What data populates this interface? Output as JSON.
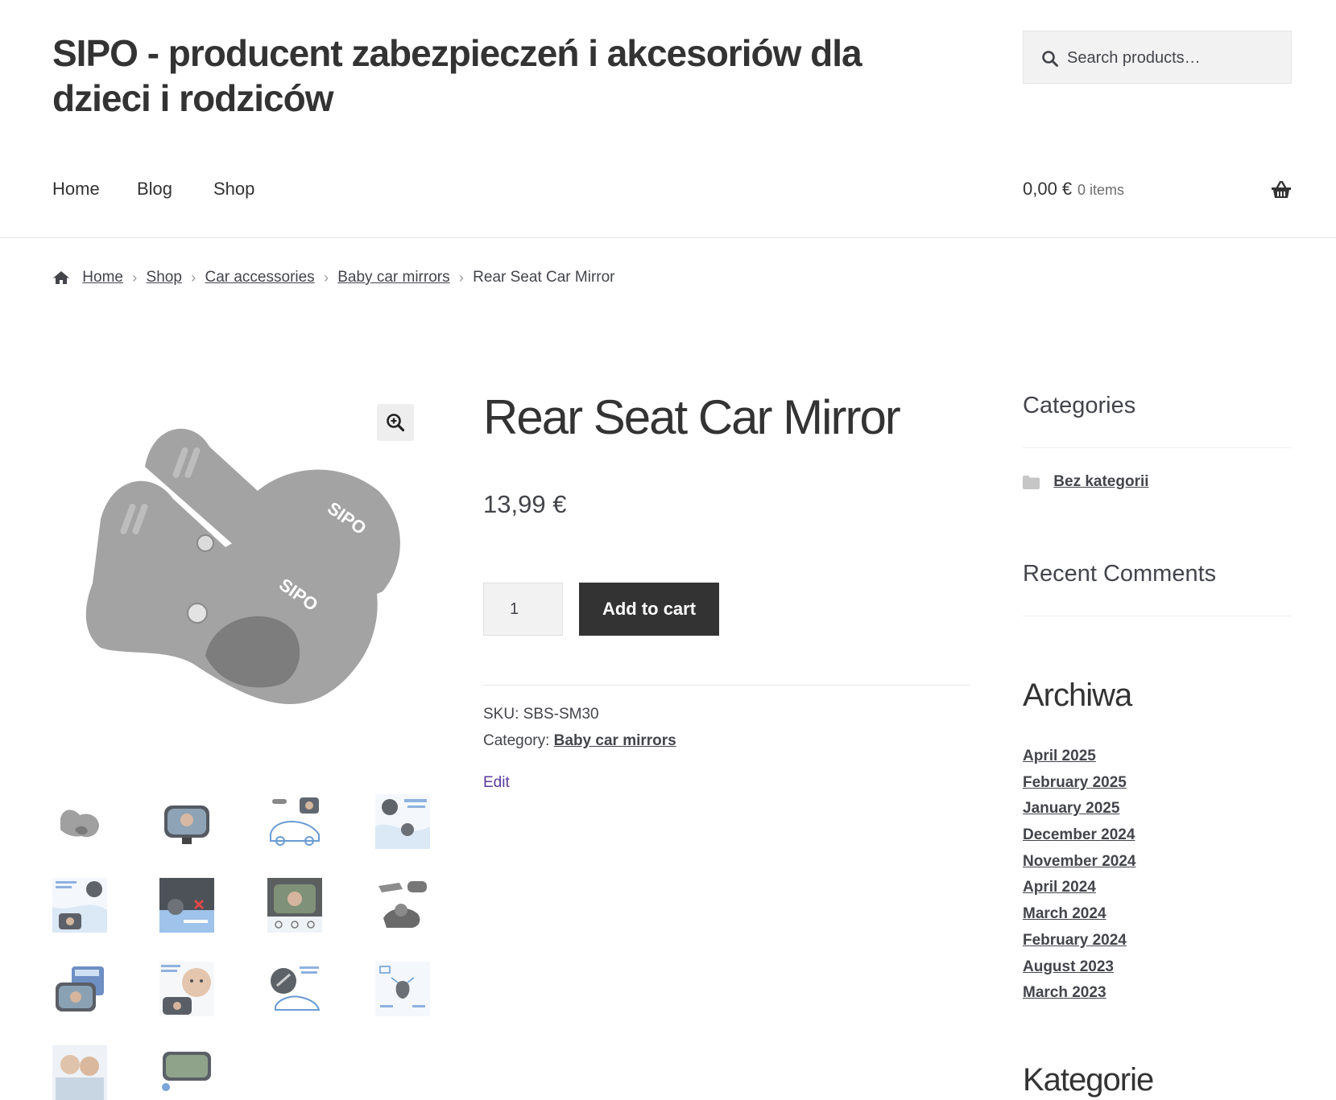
{
  "site": {
    "title": "SIPO - producent zabezpieczeń i akcesoriów dla dzieci i rodziców"
  },
  "search": {
    "placeholder": "Search products…",
    "icon": "search-icon"
  },
  "nav": {
    "items": [
      {
        "label": "Home"
      },
      {
        "label": "Blog"
      },
      {
        "label": "Shop"
      }
    ]
  },
  "cart": {
    "amount": "0,00 €",
    "count": "0 items",
    "icon": "basket-icon"
  },
  "breadcrumb": {
    "items": [
      {
        "label": "Home"
      },
      {
        "label": "Shop"
      },
      {
        "label": "Car accessories"
      },
      {
        "label": "Baby car mirrors"
      }
    ],
    "current": "Rear Seat Car Mirror"
  },
  "product": {
    "title": "Rear Seat Car Mirror",
    "price": "13,99 €",
    "quantity": "1",
    "add_to_cart": "Add to cart",
    "sku_label": "SKU:",
    "sku": "SBS-SM30",
    "category_label": "Category:",
    "category": "Baby car mirrors",
    "edit": "Edit",
    "main_image_text": "SIPO",
    "thumbnail_count": 14
  },
  "sidebar": {
    "categories_title": "Categories",
    "categories": [
      {
        "label": "Bez kategorii",
        "icon": "folder-icon"
      }
    ],
    "recent_comments_title": "Recent Comments",
    "archives_title": "Archiwa",
    "archives": [
      {
        "label": "April 2025"
      },
      {
        "label": "February 2025"
      },
      {
        "label": "January 2025"
      },
      {
        "label": "December 2024"
      },
      {
        "label": "November 2024"
      },
      {
        "label": "April 2024"
      },
      {
        "label": "March 2024"
      },
      {
        "label": "February 2024"
      },
      {
        "label": "August 2023"
      },
      {
        "label": "March 2023"
      }
    ],
    "next_widget_title": "Kategorie"
  },
  "colors": {
    "text": "#43454b",
    "heading": "#333333",
    "button_bg": "#333333",
    "edit_link": "#5b3aa0",
    "product_gray": "#a3a3a3"
  }
}
